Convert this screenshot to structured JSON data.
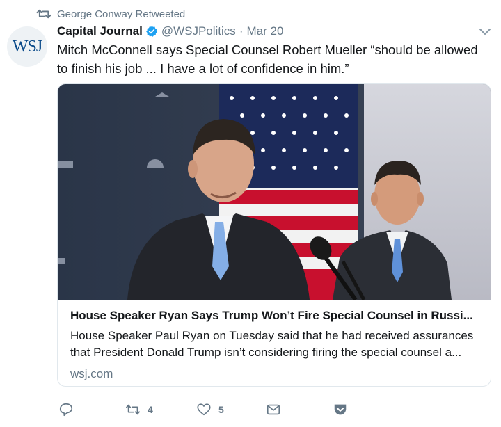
{
  "retweet_label": "George Conway Retweeted",
  "author": {
    "name": "Capital Journal",
    "handle": "@WSJPolitics",
    "separator": "·",
    "date": "Mar 20",
    "avatar_text": "WSJ"
  },
  "tweet_text": "Mitch McConnell says Special Counsel Robert Mueller “should be allowed to finish his job ... I have a lot of confidence in him.”",
  "card": {
    "title": "House Speaker Ryan Says Trump Won’t Fire Special Counsel in Russi...",
    "description": "House Speaker Paul Ryan on Tuesday said that he had received assurances that President Donald Trump isn’t considering firing the special counsel a...",
    "domain": "wsj.com"
  },
  "actions": {
    "reply_count": "",
    "retweet_count": "4",
    "like_count": "5"
  },
  "colors": {
    "accent": "#1da1f2",
    "muted": "#657786",
    "text": "#14171a",
    "border": "#e1e8ed"
  },
  "icons": [
    "retweet-icon",
    "verified-badge-icon",
    "chevron-down-icon",
    "reply-icon",
    "like-icon",
    "message-icon",
    "pocket-icon"
  ]
}
